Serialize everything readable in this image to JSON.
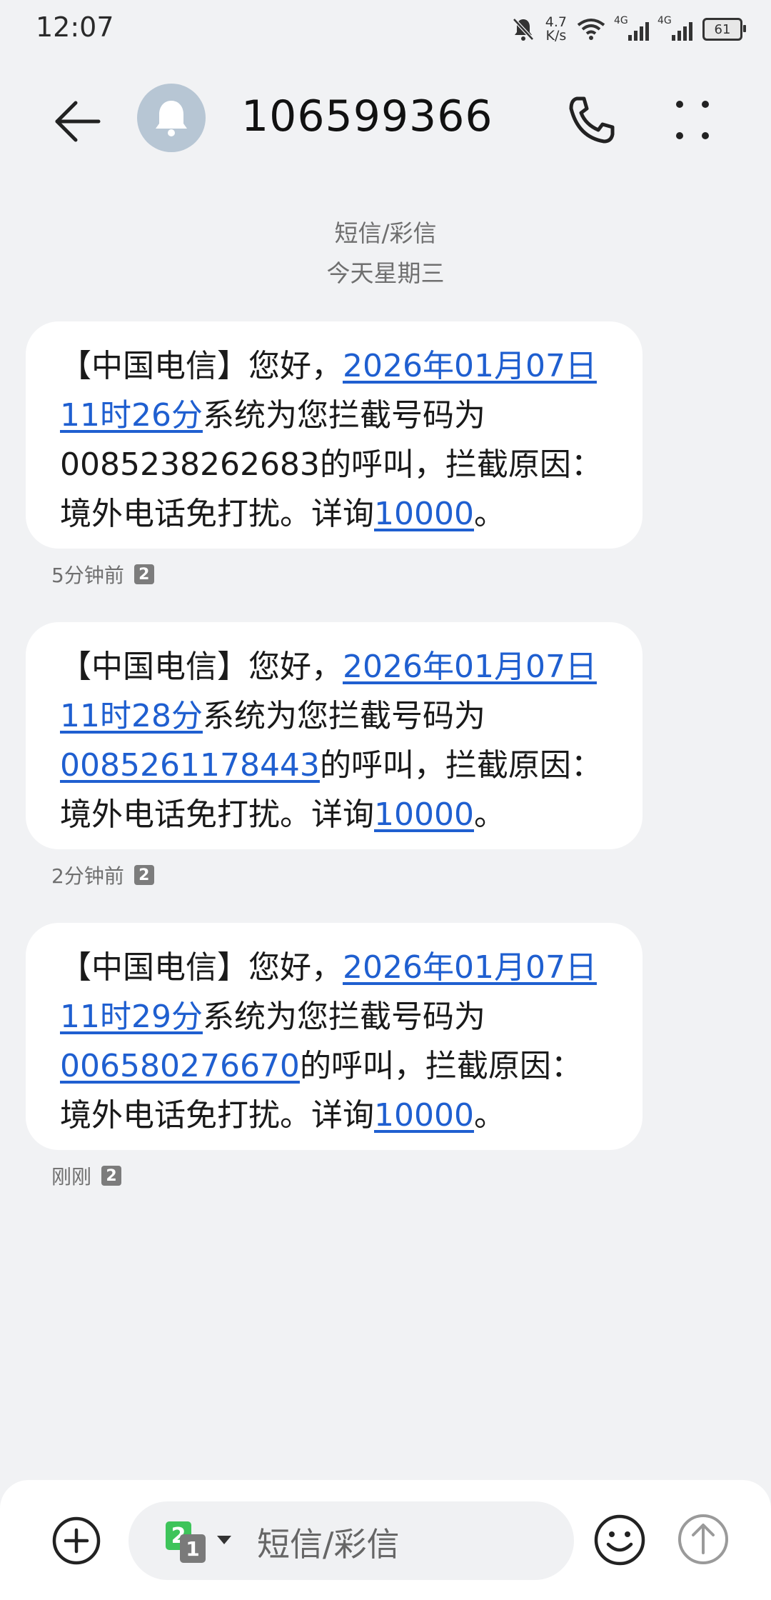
{
  "status_bar": {
    "time": "12:07",
    "net_speed_value": "4.7",
    "net_speed_unit": "K/s",
    "signal1_label": "4G",
    "signal2_label": "4G",
    "battery": "61"
  },
  "header": {
    "title": "106599366"
  },
  "date_header": {
    "channel": "短信/彩信",
    "day": "今天星期三"
  },
  "messages": [
    {
      "prefix": "【中国电信】您好，",
      "datetime": "2026年01月07日 11时26分",
      "mid": "系统为您拦截号码为",
      "number": "0085238262683",
      "number_linked": false,
      "suffix": "的呼叫，拦截原因：境外电话免打扰。详询",
      "service": "10000",
      "end": "。",
      "time_ago": "5分钟前",
      "sim": "2"
    },
    {
      "prefix": "【中国电信】您好，",
      "datetime": "2026年01月07日 11时28分",
      "mid": "系统为您拦截号码为",
      "number": "0085261178443",
      "number_linked": true,
      "suffix": "的呼叫，拦截原因：境外电话免打扰。详询",
      "service": "10000",
      "end": "。",
      "time_ago": "2分钟前",
      "sim": "2"
    },
    {
      "prefix": "【中国电信】您好，",
      "datetime": "2026年01月07日 11时29分",
      "mid": "系统为您拦截号码为",
      "number": "006580276670",
      "number_linked": true,
      "suffix": "的呼叫，拦截原因：境外电话免打扰。详询",
      "service": "10000",
      "end": "。",
      "time_ago": "刚刚",
      "sim": "2"
    }
  ],
  "composer": {
    "placeholder": "短信/彩信",
    "sim_primary": "2",
    "sim_secondary": "1"
  },
  "colors": {
    "background": "#f1f2f4",
    "link": "#1f5fd0",
    "avatar": "#b7c6d4",
    "sim_green": "#3ec45a"
  },
  "icons": {
    "back": "arrow-left-icon",
    "avatar": "bell-icon",
    "call": "phone-icon",
    "more": "more-dots-icon",
    "add": "plus-circle-icon",
    "emoji": "smiley-icon",
    "send": "arrow-up-circle-icon"
  }
}
